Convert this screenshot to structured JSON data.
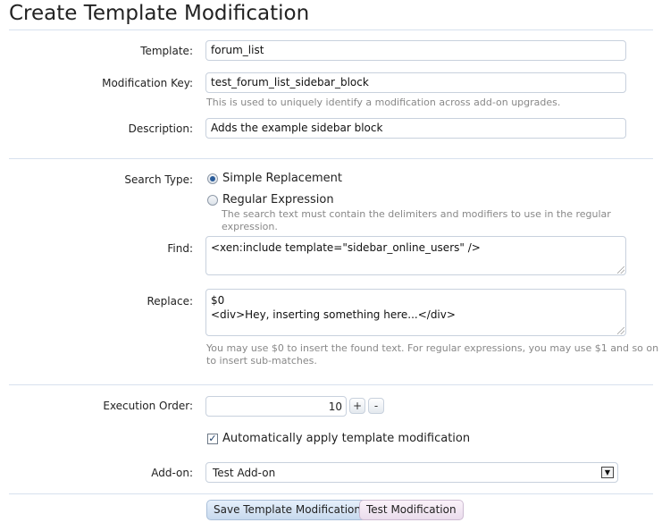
{
  "page": {
    "title": "Create Template Modification"
  },
  "form": {
    "template": {
      "label": "Template:",
      "value": "forum_list"
    },
    "modification_key": {
      "label": "Modification Key:",
      "value": "test_forum_list_sidebar_block",
      "hint": "This is used to uniquely identify a modification across add-on upgrades."
    },
    "description": {
      "label": "Description:",
      "value": "Adds the example sidebar block"
    },
    "search_type": {
      "label": "Search Type:",
      "options": [
        {
          "label": "Simple Replacement",
          "checked": true
        },
        {
          "label": "Regular Expression",
          "checked": false
        }
      ],
      "regex_hint": "The search text must contain the delimiters and modifiers to use in the regular expression."
    },
    "find": {
      "label": "Find:",
      "value": "<xen:include template=\"sidebar_online_users\" />"
    },
    "replace": {
      "label": "Replace:",
      "lines": [
        "$0",
        "<div>Hey, inserting something here...</div>"
      ],
      "hint_line1": "You may use $0 to insert the found text. For regular expressions, you may use $1 and so on",
      "hint_line2": "to insert sub-matches."
    },
    "execution_order": {
      "label": "Execution Order:",
      "value": "10",
      "plus": "+",
      "minus": "-"
    },
    "auto_apply": {
      "label": "Automatically apply template modification",
      "checked": true,
      "mark": "✓"
    },
    "addon": {
      "label": "Add-on:",
      "value": "Test Add-on",
      "arrow": "▼"
    }
  },
  "buttons": {
    "save": "Save Template Modification",
    "test": "Test Modification"
  },
  "colors": {
    "divider": "#d7e1ee",
    "input_border": "#c8d1dd",
    "hint_text": "#888888",
    "radio_selected": "#2a5c9a"
  }
}
